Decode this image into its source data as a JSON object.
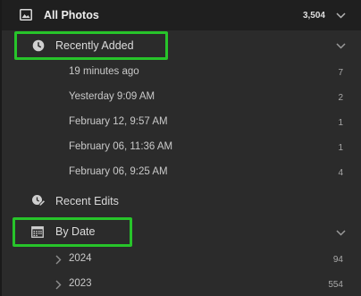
{
  "all_photos": {
    "title": "All Photos",
    "count": "3,504"
  },
  "recently_added": {
    "label": "Recently Added",
    "items": [
      {
        "label": "19 minutes ago",
        "count": "7"
      },
      {
        "label": "Yesterday 9:09 AM",
        "count": "2"
      },
      {
        "label": "February 12, 9:57 AM",
        "count": "1"
      },
      {
        "label": "February 06, 11:36 AM",
        "count": "1"
      },
      {
        "label": "February 06, 9:25 AM",
        "count": "4"
      }
    ]
  },
  "recent_edits": {
    "label": "Recent Edits"
  },
  "by_date": {
    "label": "By Date",
    "years": [
      {
        "label": "2024",
        "count": "94"
      },
      {
        "label": "2023",
        "count": "554"
      }
    ]
  },
  "colors": {
    "highlight": "#27c42a",
    "header_bg": "#1f1f1f",
    "panel_bg": "#2b2b2b"
  }
}
